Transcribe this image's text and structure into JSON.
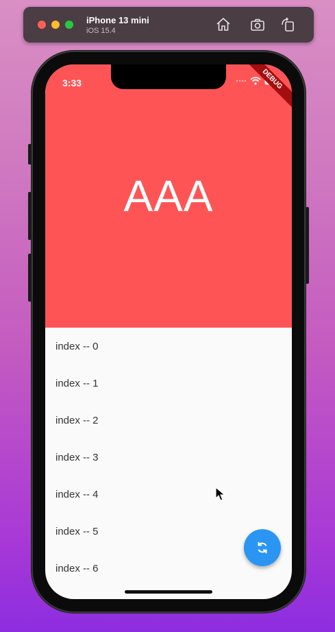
{
  "simulator": {
    "device_name": "iPhone 13 mini",
    "os_version": "iOS 15.4",
    "buttons": [
      "home-icon",
      "screenshot-icon",
      "rotate-icon"
    ]
  },
  "status_bar": {
    "time": "3:33",
    "debug_label": "DEBUG"
  },
  "header": {
    "title": "AAA",
    "background": "#fe5454"
  },
  "list": {
    "items": [
      "index -- 0",
      "index -- 1",
      "index -- 2",
      "index -- 3",
      "index -- 4",
      "index -- 5",
      "index -- 6"
    ]
  },
  "fab": {
    "icon": "refresh-icon",
    "color": "#2a95f3"
  }
}
